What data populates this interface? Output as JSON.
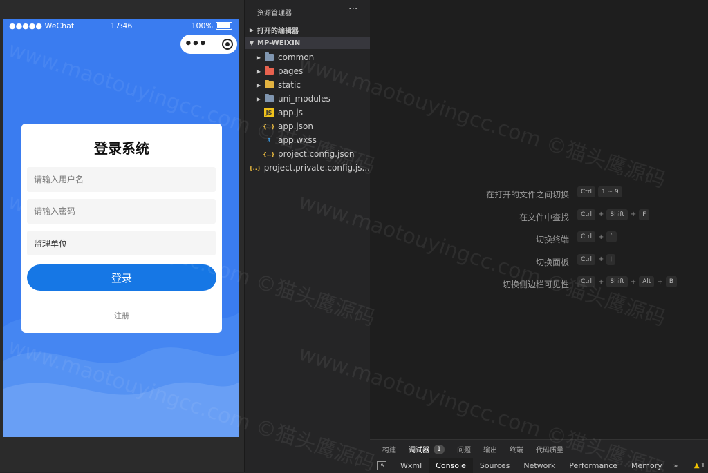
{
  "simulator": {
    "status_left": "●●●●● WeChat",
    "status_time": "17:46",
    "status_battery": "100%",
    "capsule_more": "•••"
  },
  "login": {
    "title": "登录系统",
    "username_placeholder": "请输入用户名",
    "password_placeholder": "请输入密码",
    "unit_value": "监理单位",
    "login_label": "登录",
    "register_label": "注册"
  },
  "explorer": {
    "header": "资源管理器",
    "more": "···",
    "open_editors": "打开的编辑器",
    "project": "MP-WEIXIN",
    "items": [
      {
        "label": "common",
        "kind": "folder",
        "icon": "folder-icon",
        "color": "#8096b0"
      },
      {
        "label": "pages",
        "kind": "folder",
        "icon": "folder-pages-icon",
        "color": "#e8624f"
      },
      {
        "label": "static",
        "kind": "folder",
        "icon": "folder-static-icon",
        "color": "#e3b341"
      },
      {
        "label": "uni_modules",
        "kind": "folder",
        "icon": "folder-icon",
        "color": "#8096b0"
      },
      {
        "label": "app.js",
        "kind": "js",
        "icon": "js-file-icon"
      },
      {
        "label": "app.json",
        "kind": "json",
        "icon": "json-file-icon"
      },
      {
        "label": "app.wxss",
        "kind": "css",
        "icon": "css-file-icon"
      },
      {
        "label": "project.config.json",
        "kind": "json",
        "icon": "json-file-icon"
      },
      {
        "label": "project.private.config.js...",
        "kind": "json",
        "icon": "json-file-icon"
      }
    ]
  },
  "shortcuts": [
    {
      "label": "在打开的文件之间切换",
      "keys": [
        "Ctrl",
        "1 ~ 9"
      ]
    },
    {
      "label": "在文件中查找",
      "keys": [
        "Ctrl",
        "+",
        "Shift",
        "+",
        "F"
      ]
    },
    {
      "label": "切换终端",
      "keys": [
        "Ctrl",
        "+",
        "`"
      ]
    },
    {
      "label": "切换面板",
      "keys": [
        "Ctrl",
        "+",
        "J"
      ]
    },
    {
      "label": "切换侧边栏可见性",
      "keys": [
        "Ctrl",
        "+",
        "Shift",
        "+",
        "Alt",
        "+",
        "B"
      ]
    }
  ],
  "panel_tabs": [
    {
      "label": "构建"
    },
    {
      "label": "调试器",
      "badge": "1",
      "active": true
    },
    {
      "label": "问题"
    },
    {
      "label": "输出"
    },
    {
      "label": "终端"
    },
    {
      "label": "代码质量"
    }
  ],
  "devtools_tabs": [
    {
      "label": "Wxml"
    },
    {
      "label": "Console",
      "active": true
    },
    {
      "label": "Sources"
    },
    {
      "label": "Network"
    },
    {
      "label": "Performance"
    },
    {
      "label": "Memory"
    }
  ],
  "devtools_more": "»",
  "warning_count": "1",
  "watermark": "www.maotouyingcc.com ©猫头鹰源码"
}
